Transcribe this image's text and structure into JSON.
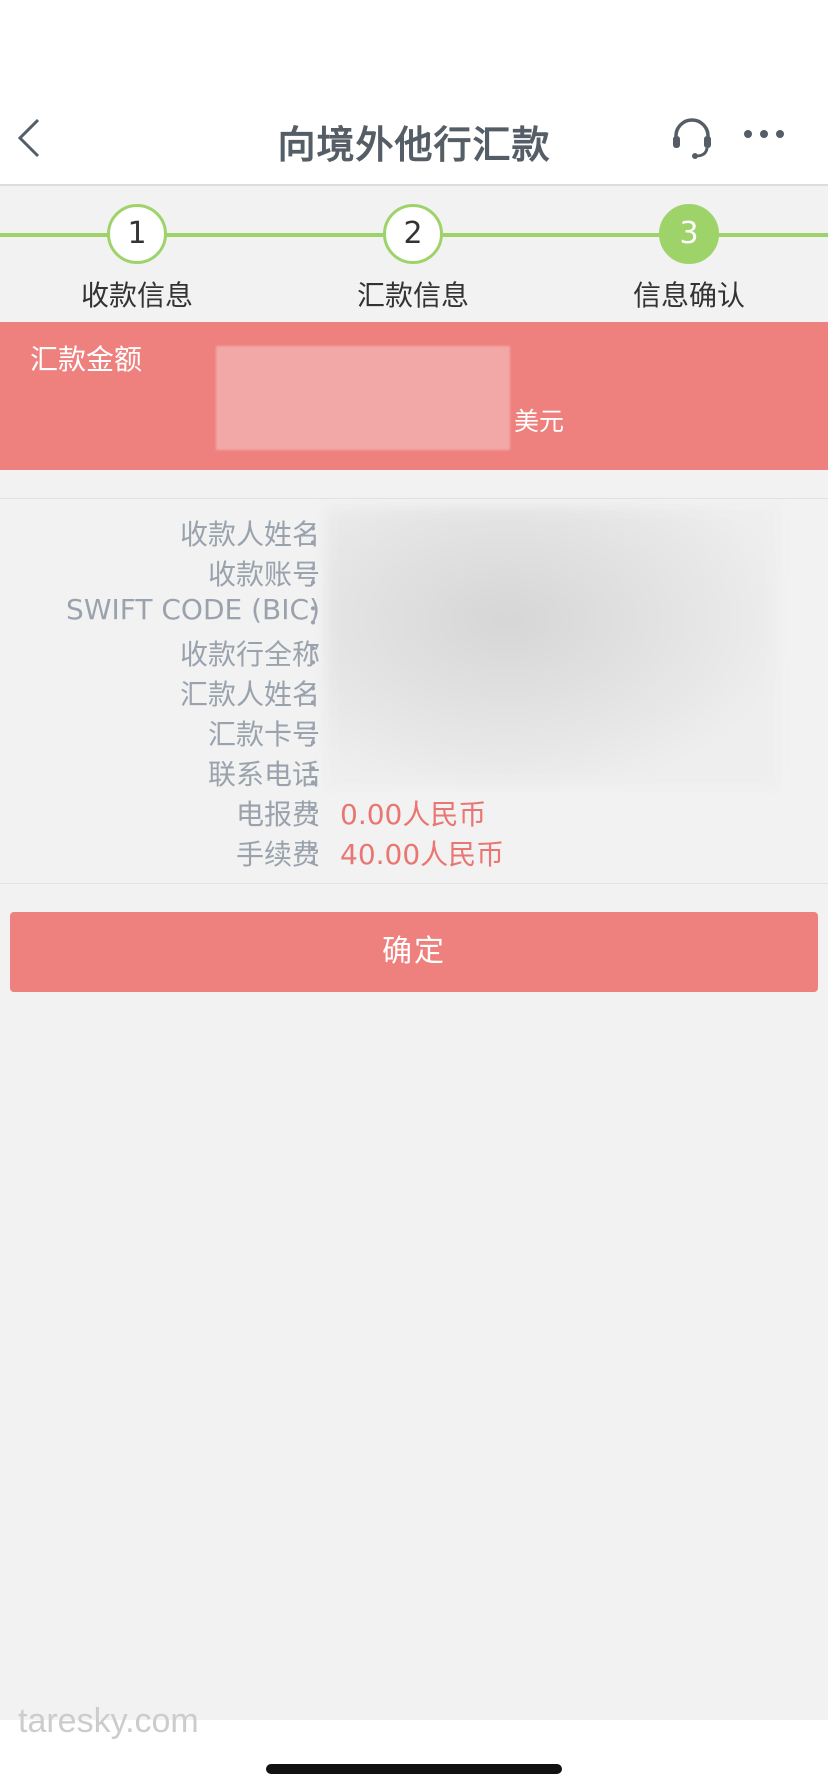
{
  "nav": {
    "title": "向境外他行汇款",
    "back_icon": "chevron-left-icon",
    "service_icon": "headset-icon",
    "more_icon": "more-dots-icon"
  },
  "steps": [
    {
      "number": "1",
      "label": "收款信息",
      "active": false
    },
    {
      "number": "2",
      "label": "汇款信息",
      "active": false
    },
    {
      "number": "3",
      "label": "信息确认",
      "active": true
    }
  ],
  "amount": {
    "label": "汇款金额",
    "currency": "美元"
  },
  "details": {
    "rows": [
      {
        "label": "收款人姓名",
        "value": ""
      },
      {
        "label": "收款账号",
        "value": ""
      },
      {
        "label": "SWIFT CODE (BIC)",
        "value": ""
      },
      {
        "label": "收款行全称",
        "value": ""
      },
      {
        "label": "汇款人姓名",
        "value": ""
      },
      {
        "label": "汇款卡号",
        "value": ""
      },
      {
        "label": "联系电话",
        "value": ""
      },
      {
        "label": "电报费",
        "value": "0.00人民币"
      },
      {
        "label": "手续费",
        "value": "40.00人民币"
      }
    ],
    "colon": "："
  },
  "confirm_button": "确定",
  "watermark": "taresky.com",
  "colors": {
    "accent": "#ee817d",
    "step_green": "#9ed36a",
    "label_gray": "#9aa3ad",
    "value_red": "#e97672"
  }
}
